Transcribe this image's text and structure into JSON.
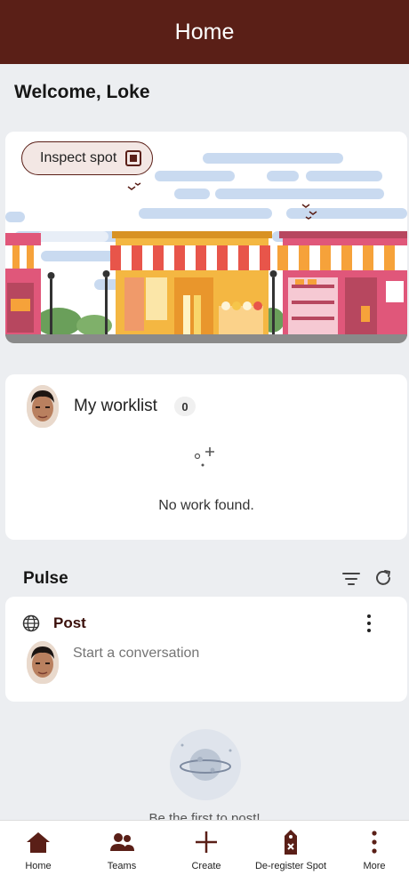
{
  "header": {
    "title": "Home"
  },
  "welcome": "Welcome, Loke",
  "banner": {
    "inspect_label": "Inspect spot"
  },
  "worklist": {
    "title": "My worklist",
    "count": "0",
    "empty_text": "No work found."
  },
  "pulse": {
    "title": "Pulse"
  },
  "post": {
    "label": "Post",
    "placeholder": "Start a conversation"
  },
  "first_post_text": "Be the first to post!",
  "nav": [
    {
      "label": "Home",
      "icon": "home-icon"
    },
    {
      "label": "Teams",
      "icon": "teams-icon"
    },
    {
      "label": "Create",
      "icon": "plus-icon"
    },
    {
      "label": "De-register Spot",
      "icon": "deregister-tag-icon"
    },
    {
      "label": "More",
      "icon": "more-icon"
    }
  ],
  "colors": {
    "accent": "#5a1f17",
    "background": "#eceef1"
  }
}
